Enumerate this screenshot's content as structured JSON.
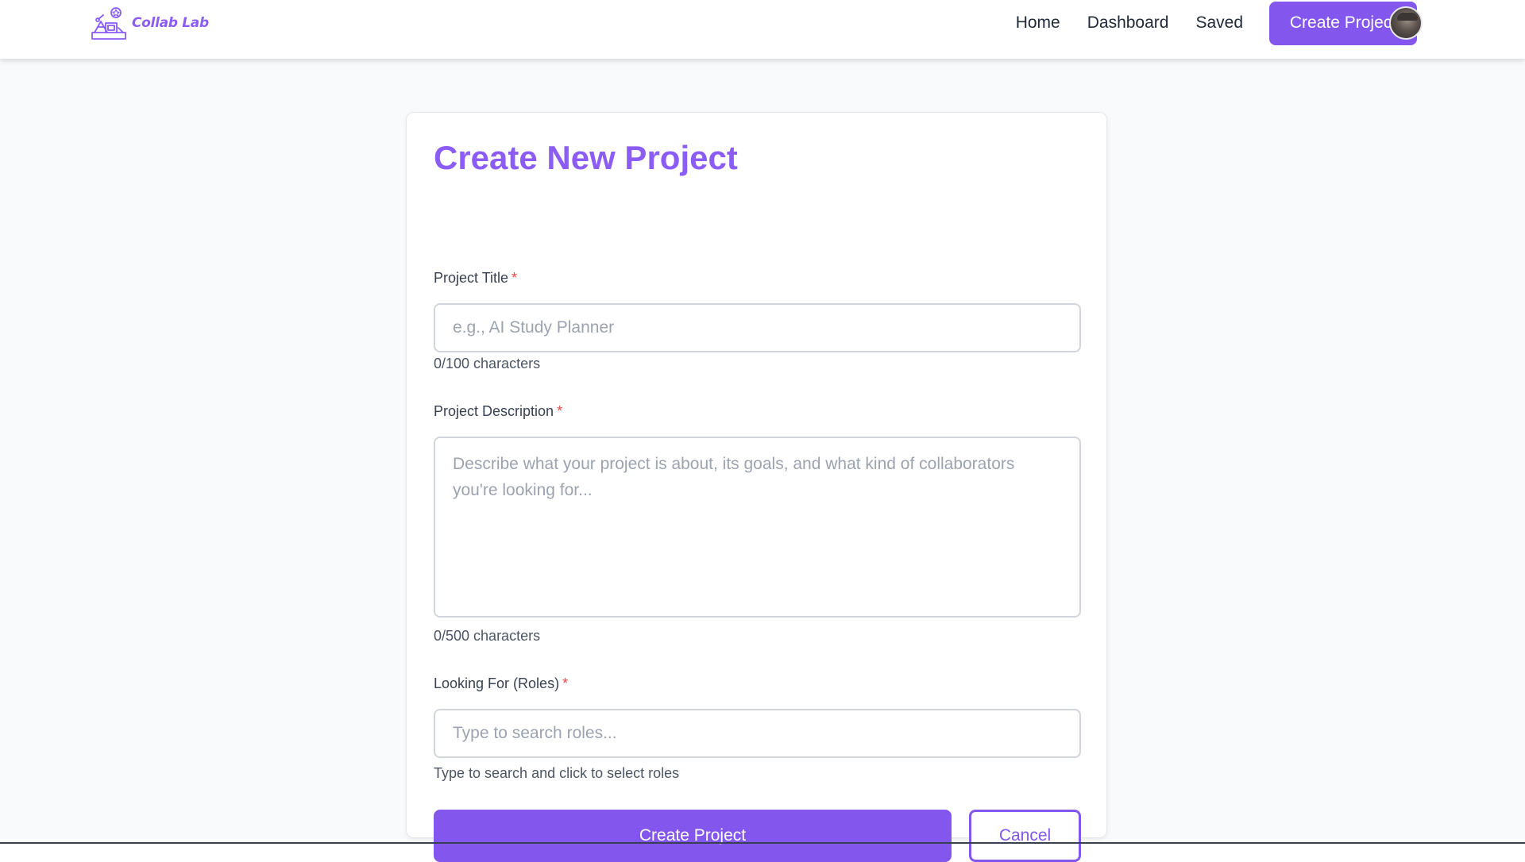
{
  "brand": {
    "name": "Collab Lab",
    "logo_icon": "collab-lab-logo-icon",
    "color": "#8b5cf6"
  },
  "nav": {
    "home": "Home",
    "dashboard": "Dashboard",
    "saved": "Saved",
    "create_project": "Create Project",
    "avatar_icon": "user-avatar"
  },
  "form": {
    "title": "Create New Project",
    "project_title": {
      "label": "Project Title",
      "required_mark": "*",
      "placeholder": "e.g., AI Study Planner",
      "value": "",
      "counter": "0/100 characters"
    },
    "project_description": {
      "label": "Project Description",
      "required_mark": "*",
      "placeholder": "Describe what your project is about, its goals, and what kind of collaborators you're looking for...",
      "value": "",
      "counter": "0/500 characters"
    },
    "roles": {
      "label": "Looking For (Roles)",
      "required_mark": "*",
      "placeholder": "Type to search roles...",
      "value": "",
      "hint": "Type to search and click to select roles"
    },
    "submit_label": "Create Project",
    "cancel_label": "Cancel"
  },
  "colors": {
    "accent": "#8357ed",
    "title_accent": "#8b5cf6",
    "required": "#ef4444",
    "page_bg": "#f9fafb"
  }
}
